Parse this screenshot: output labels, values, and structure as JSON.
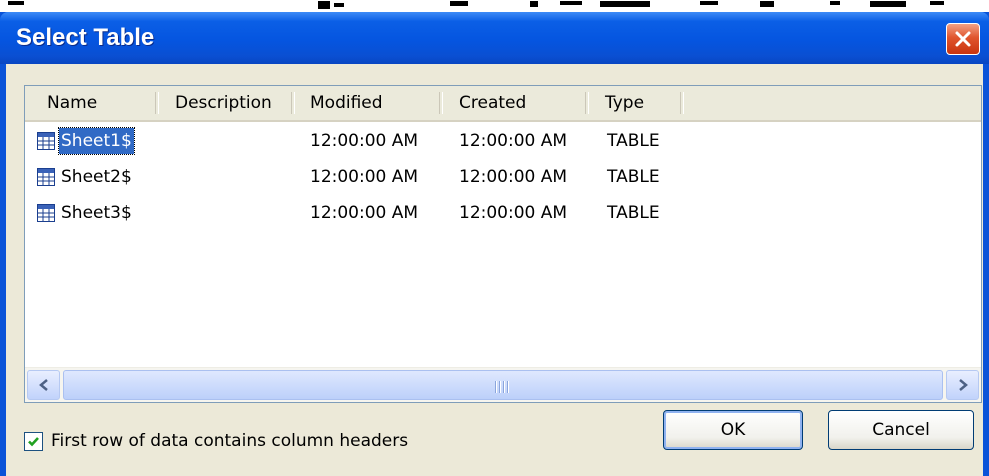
{
  "window": {
    "title": "Select Table"
  },
  "listview": {
    "columns": [
      "Name",
      "Description",
      "Modified",
      "Created",
      "Type"
    ],
    "rows": [
      {
        "name": "Sheet1$",
        "description": "",
        "modified": "12:00:00 AM",
        "created": "12:00:00 AM",
        "type": "TABLE",
        "selected": true
      },
      {
        "name": "Sheet2$",
        "description": "",
        "modified": "12:00:00 AM",
        "created": "12:00:00 AM",
        "type": "TABLE",
        "selected": false
      },
      {
        "name": "Sheet3$",
        "description": "",
        "modified": "12:00:00 AM",
        "created": "12:00:00 AM",
        "type": "TABLE",
        "selected": false
      }
    ],
    "row_icon": "table-icon"
  },
  "options": {
    "first_row_headers_label": "First row of data contains column headers",
    "first_row_headers_checked": true
  },
  "buttons": {
    "ok": "OK",
    "cancel": "Cancel"
  },
  "colors": {
    "titlebar": "#0555e0",
    "selection": "#316ac5",
    "close": "#e0552e",
    "dialog_bg": "#ece9d8"
  }
}
